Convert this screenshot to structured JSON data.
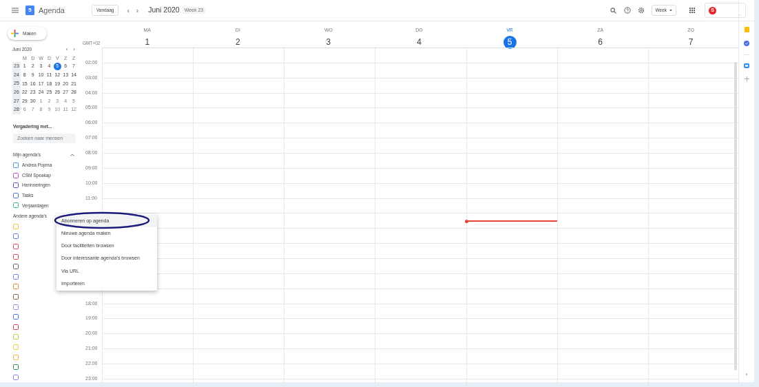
{
  "header": {
    "app_title": "Agenda",
    "logo_day": "5",
    "today_button": "Vandaag",
    "prev": "‹",
    "next": "›",
    "period": "Juni 2020",
    "week_badge": "Week 23",
    "view_select": "Week",
    "avatar_letter": "S",
    "account_extra": "_"
  },
  "create_button": "Maken",
  "mini_calendar": {
    "title": "Juni 2020",
    "weekdays": [
      "M",
      "D",
      "W",
      "D",
      "V",
      "Z",
      "Z"
    ],
    "weeks": [
      {
        "number": "23",
        "days": [
          {
            "d": "1",
            "muted": false,
            "selected": false
          },
          {
            "d": "2",
            "muted": false,
            "selected": false
          },
          {
            "d": "3",
            "muted": false,
            "selected": false
          },
          {
            "d": "4",
            "muted": false,
            "selected": false
          },
          {
            "d": "5",
            "muted": false,
            "selected": true
          },
          {
            "d": "6",
            "muted": false,
            "selected": false
          },
          {
            "d": "7",
            "muted": false,
            "selected": false
          }
        ]
      },
      {
        "number": "24",
        "days": [
          {
            "d": "8",
            "muted": false,
            "selected": false
          },
          {
            "d": "9",
            "muted": false,
            "selected": false
          },
          {
            "d": "10",
            "muted": false,
            "selected": false
          },
          {
            "d": "11",
            "muted": false,
            "selected": false
          },
          {
            "d": "12",
            "muted": false,
            "selected": false
          },
          {
            "d": "13",
            "muted": false,
            "selected": false
          },
          {
            "d": "14",
            "muted": false,
            "selected": false
          }
        ]
      },
      {
        "number": "25",
        "days": [
          {
            "d": "15",
            "muted": false,
            "selected": false
          },
          {
            "d": "16",
            "muted": false,
            "selected": false
          },
          {
            "d": "17",
            "muted": false,
            "selected": false
          },
          {
            "d": "18",
            "muted": false,
            "selected": false
          },
          {
            "d": "19",
            "muted": false,
            "selected": false
          },
          {
            "d": "20",
            "muted": false,
            "selected": false
          },
          {
            "d": "21",
            "muted": false,
            "selected": false
          }
        ]
      },
      {
        "number": "26",
        "days": [
          {
            "d": "22",
            "muted": false,
            "selected": false
          },
          {
            "d": "23",
            "muted": false,
            "selected": false
          },
          {
            "d": "24",
            "muted": false,
            "selected": false
          },
          {
            "d": "25",
            "muted": false,
            "selected": false
          },
          {
            "d": "26",
            "muted": false,
            "selected": false
          },
          {
            "d": "27",
            "muted": false,
            "selected": false
          },
          {
            "d": "28",
            "muted": false,
            "selected": false
          }
        ]
      },
      {
        "number": "27",
        "days": [
          {
            "d": "29",
            "muted": false,
            "selected": false
          },
          {
            "d": "30",
            "muted": false,
            "selected": false
          },
          {
            "d": "1",
            "muted": true,
            "selected": false
          },
          {
            "d": "2",
            "muted": true,
            "selected": false
          },
          {
            "d": "3",
            "muted": true,
            "selected": false
          },
          {
            "d": "4",
            "muted": true,
            "selected": false
          },
          {
            "d": "5",
            "muted": true,
            "selected": false
          }
        ]
      },
      {
        "number": "28",
        "days": [
          {
            "d": "6",
            "muted": true,
            "selected": false
          },
          {
            "d": "7",
            "muted": true,
            "selected": false
          },
          {
            "d": "8",
            "muted": true,
            "selected": false
          },
          {
            "d": "9",
            "muted": true,
            "selected": false
          },
          {
            "d": "10",
            "muted": true,
            "selected": false
          },
          {
            "d": "11",
            "muted": true,
            "selected": false
          },
          {
            "d": "12",
            "muted": true,
            "selected": false
          }
        ]
      }
    ]
  },
  "meet_with": {
    "title": "Vergadering met...",
    "placeholder": "Zoeken naar mensen"
  },
  "my_calendars": {
    "title": "Mijn agenda's",
    "expanded": true,
    "items": [
      {
        "label": "Andrea Popma",
        "color": "#4a8ef0",
        "checked": false
      },
      {
        "label": "CSM Speakap",
        "color": "#b44fc4",
        "checked": false
      },
      {
        "label": "Herinneringen",
        "color": "#5c4fbf",
        "checked": false
      },
      {
        "label": "Tasks",
        "color": "#4f6fd0",
        "checked": false
      },
      {
        "label": "Verjaardagen",
        "color": "#35b879",
        "checked": false
      }
    ]
  },
  "other_calendars": {
    "title": "Andere agenda's",
    "items": [
      {
        "color": "#f2c12e",
        "checked": false
      },
      {
        "color": "#5a7be0",
        "checked": false
      },
      {
        "color": "#e0405a",
        "checked": false
      },
      {
        "color": "#e04646",
        "checked": false
      },
      {
        "color": "#616161",
        "checked": false
      },
      {
        "color": "#6d7fe8",
        "checked": false
      },
      {
        "color": "#f5902e",
        "checked": false
      },
      {
        "color": "#8d5a45",
        "checked": false
      },
      {
        "color": "#8e8ee0",
        "checked": false
      },
      {
        "color": "#4a6fe0",
        "checked": false
      },
      {
        "color": "#d83a4a",
        "checked": false
      },
      {
        "color": "#b8d23a",
        "checked": false
      },
      {
        "color": "#f5c43a",
        "checked": false
      },
      {
        "color": "#f5b83a",
        "checked": false
      },
      {
        "color": "#2e8b50",
        "checked": false
      },
      {
        "color": "#8a86d8",
        "checked": false
      }
    ]
  },
  "week": {
    "timezone": "GMT+02",
    "days": [
      {
        "weekday": "MA",
        "date": "1",
        "selected": false,
        "now_line": false
      },
      {
        "weekday": "DI",
        "date": "2",
        "selected": false,
        "now_line": false
      },
      {
        "weekday": "WO",
        "date": "3",
        "selected": false,
        "now_line": false
      },
      {
        "weekday": "DO",
        "date": "4",
        "selected": false,
        "now_line": false
      },
      {
        "weekday": "VR",
        "date": "5",
        "selected": true,
        "now_line": true
      },
      {
        "weekday": "ZA",
        "date": "6",
        "selected": false,
        "now_line": false
      },
      {
        "weekday": "ZO",
        "date": "7",
        "selected": false,
        "now_line": false
      }
    ],
    "time_labels_upper": [
      "02:00",
      "03:00",
      "04:00",
      "05:00",
      "06:00",
      "07:00",
      "08:00",
      "09:00",
      "10:00",
      "11:00"
    ],
    "time_labels_lower": [
      "18:00",
      "19:00",
      "20:00",
      "21:00",
      "22:00",
      "23:00"
    ]
  },
  "menu": {
    "items": [
      {
        "label": "Abonneren op agenda",
        "selected": true
      },
      {
        "label": "Nieuwe agenda maken",
        "selected": false
      },
      {
        "label": "Door faciliteiten browsen",
        "selected": false
      },
      {
        "label": "Door interessante agenda's browsen",
        "selected": false
      },
      {
        "label": "Via URL",
        "selected": false
      },
      {
        "label": "Importeren",
        "selected": false
      }
    ]
  },
  "side_panel": {
    "expand": "›"
  }
}
